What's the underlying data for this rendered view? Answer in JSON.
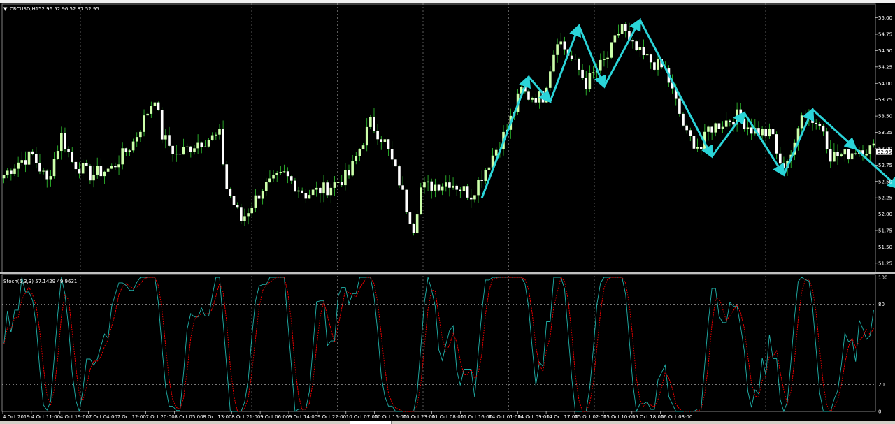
{
  "header": {
    "symbol": "CRCUSD,H1",
    "ohlc": "52.96 52.96 52.87 52.95"
  },
  "current_price": "52.95",
  "indicator_label": "Stoch(5,3,3) 57.1429 49.9631",
  "price_axis": [
    "55.00",
    "54.75",
    "54.50",
    "54.25",
    "54.00",
    "53.75",
    "53.50",
    "53.25",
    "53.00",
    "52.75",
    "52.50",
    "52.25",
    "52.00",
    "51.75",
    "51.50",
    "51.25"
  ],
  "stoch_axis": [
    "100",
    "80",
    "20",
    "0"
  ],
  "time_axis": [
    "4 Oct 2019",
    "4 Oct 11:00",
    "4 Oct 19:00",
    "7 Oct 04:00",
    "7 Oct 12:00",
    "7 Oct 20:00",
    "8 Oct 05:00",
    "8 Oct 13:00",
    "8 Oct 21:00",
    "9 Oct 06:00",
    "9 Oct 14:00",
    "9 Oct 22:00",
    "10 Oct 07:00",
    "10 Oct 15:00",
    "10 Oct 23:00",
    "11 Oct 08:00",
    "11 Oct 16:00",
    "14 Oct 01:00",
    "14 Oct 09:00",
    "14 Oct 17:00",
    "15 Oct 02:00",
    "15 Oct 10:00",
    "15 Oct 18:00",
    "16 Oct 03:00"
  ],
  "colors": {
    "background": "#000000",
    "bull": "#ccffaa",
    "bear": "#ffffff",
    "wick": "#32cd32",
    "grid": "#c0c0c0",
    "arrow": "#2ad4d8",
    "stoch_main": "#20b2aa",
    "stoch_signal": "#ff0000",
    "bid_line": "#808080"
  },
  "chart_data": {
    "type": "candlestick",
    "price_range": [
      51.12,
      55.22
    ],
    "stoch_range": [
      0,
      100
    ],
    "stoch_levels": [
      20,
      80
    ],
    "anchors": [
      [
        0,
        52.6
      ],
      [
        4,
        52.8
      ],
      [
        8,
        52.9
      ],
      [
        12,
        52.5
      ],
      [
        16,
        53.2
      ],
      [
        19,
        52.8
      ],
      [
        24,
        52.6
      ],
      [
        30,
        52.7
      ],
      [
        36,
        53.1
      ],
      [
        42,
        53.8
      ],
      [
        44,
        53.2
      ],
      [
        48,
        52.9
      ],
      [
        54,
        53.1
      ],
      [
        60,
        53.2
      ],
      [
        62,
        52.4
      ],
      [
        66,
        51.9
      ],
      [
        72,
        52.4
      ],
      [
        78,
        52.6
      ],
      [
        84,
        52.3
      ],
      [
        90,
        52.4
      ],
      [
        96,
        52.6
      ],
      [
        102,
        53.4
      ],
      [
        106,
        53.1
      ],
      [
        110,
        52.5
      ],
      [
        112,
        52.1
      ],
      [
        114,
        51.8
      ],
      [
        116,
        52.4
      ],
      [
        124,
        52.5
      ],
      [
        130,
        52.3
      ],
      [
        136,
        52.9
      ],
      [
        140,
        53.3
      ],
      [
        144,
        53.9
      ],
      [
        146,
        53.8
      ],
      [
        150,
        53.8
      ],
      [
        154,
        54.7
      ],
      [
        160,
        54.2
      ],
      [
        162,
        54.0
      ],
      [
        168,
        54.4
      ],
      [
        172,
        54.9
      ],
      [
        174,
        54.6
      ],
      [
        178,
        54.4
      ],
      [
        184,
        54.2
      ],
      [
        190,
        53.2
      ],
      [
        194,
        53.0
      ],
      [
        196,
        53.3
      ],
      [
        200,
        53.4
      ],
      [
        204,
        53.5
      ],
      [
        208,
        53.3
      ],
      [
        214,
        53.2
      ],
      [
        216,
        52.7
      ],
      [
        220,
        53.0
      ],
      [
        222,
        53.6
      ],
      [
        228,
        53.3
      ],
      [
        230,
        52.9
      ],
      [
        234,
        52.9
      ],
      [
        238,
        53.0
      ]
    ],
    "arrows": [
      [
        133,
        52.25
      ],
      [
        146,
        54.1
      ],
      [
        152,
        53.72
      ],
      [
        160,
        54.88
      ],
      [
        167,
        53.95
      ],
      [
        177,
        54.97
      ],
      [
        197,
        52.88
      ],
      [
        206,
        53.55
      ],
      [
        217,
        52.6
      ],
      [
        225,
        53.6
      ],
      [
        237,
        53.0
      ],
      [
        249,
        52.4
      ]
    ]
  }
}
